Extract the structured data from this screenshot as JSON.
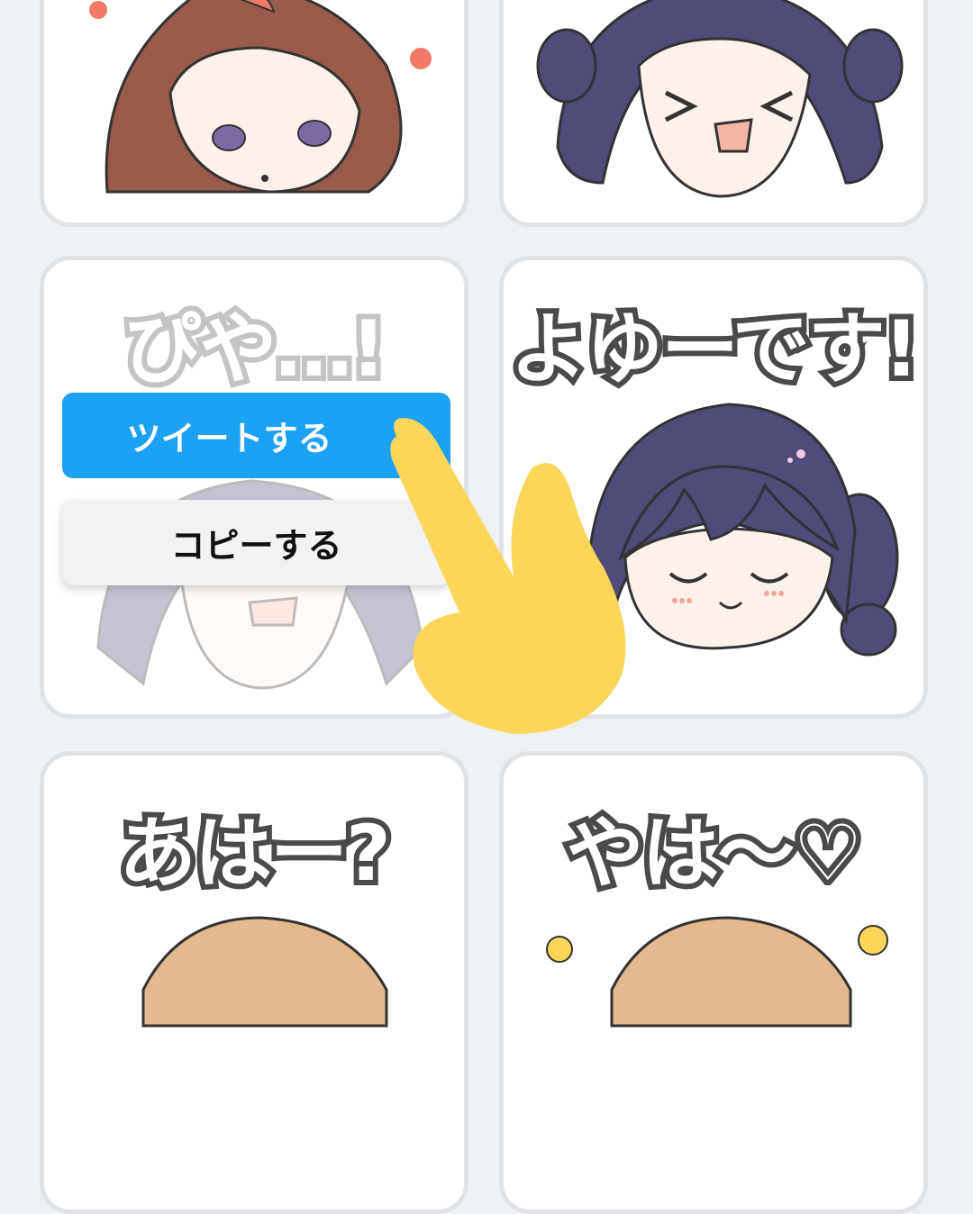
{
  "stickers": [
    {
      "id": 1,
      "caption": ""
    },
    {
      "id": 2,
      "caption": ""
    },
    {
      "id": 3,
      "caption": "ぴや…!"
    },
    {
      "id": 4,
      "caption": "よゆーです!"
    },
    {
      "id": 5,
      "caption": "あはー?"
    },
    {
      "id": 6,
      "caption": "やは〜♡"
    }
  ],
  "menu": {
    "tweet_label": "ツイートする",
    "copy_label": "コピーする"
  },
  "colors": {
    "background": "#eef1f3",
    "card_border": "#dfe3e6",
    "tweet_button": "#1da1f2",
    "copy_button": "#f1f2f4",
    "hand": "#fbd65a",
    "hair_purple": "#4f4c7a",
    "hair_brown": "#9a5a4b"
  }
}
